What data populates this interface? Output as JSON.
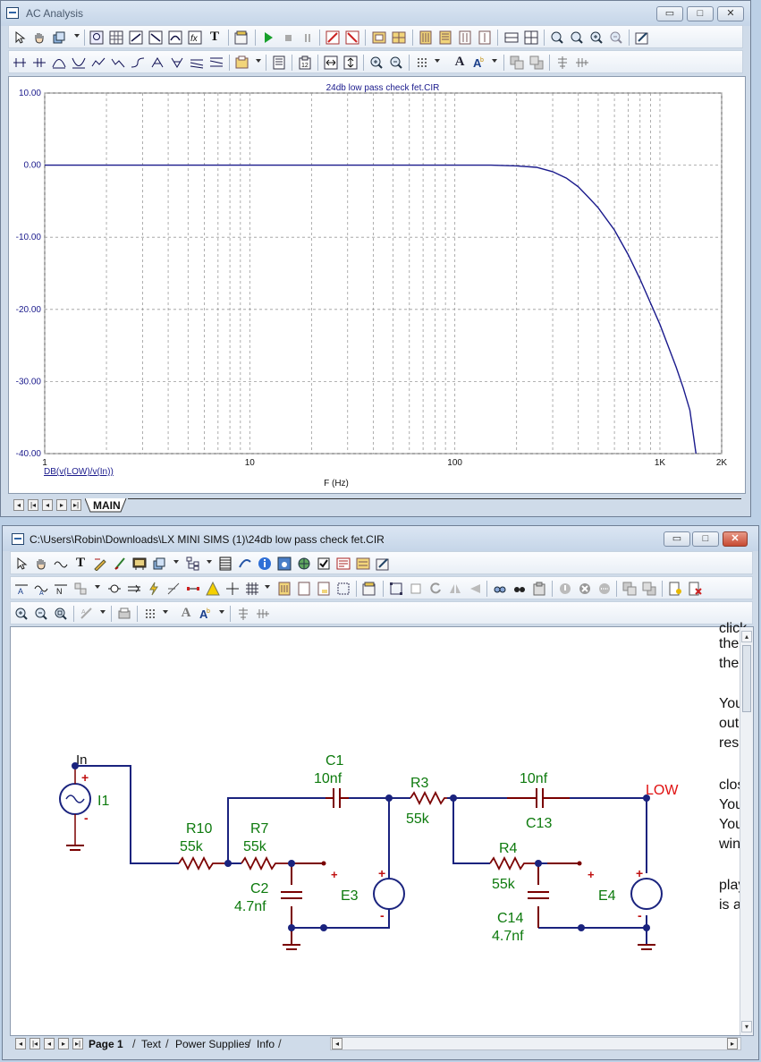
{
  "ac_window": {
    "title": "AC Analysis",
    "buttons": {
      "minimize": "▭",
      "restore": "□",
      "close": "✕"
    },
    "plot": {
      "title": "24db low pass check fet.CIR",
      "y_ticks": [
        "10.00",
        "0.00",
        "-10.00",
        "-20.00",
        "-30.00",
        "-40.00"
      ],
      "x_ticks": [
        "1",
        "10",
        "100",
        "1K",
        "2K"
      ],
      "x_label": "F (Hz)",
      "trace_label": "DB(v(LOW)/v(In))"
    },
    "tabs": [
      {
        "label": "MAIN"
      }
    ]
  },
  "chart_data": {
    "type": "line",
    "title": "24db low pass check fet.CIR",
    "xlabel": "F (Hz)",
    "ylabel": "",
    "x_scale": "log",
    "xlim": [
      1,
      2000
    ],
    "ylim": [
      -40,
      10
    ],
    "grid": true,
    "series": [
      {
        "name": "DB(v(LOW)/v(In))",
        "color": "#1a1a8c",
        "x": [
          1,
          10,
          50,
          100,
          150,
          200,
          250,
          300,
          350,
          400,
          450,
          500,
          600,
          700,
          800,
          1000,
          1200,
          1300,
          1400,
          1500
        ],
        "y": [
          0,
          0,
          0,
          0,
          0,
          -0.1,
          -0.3,
          -0.9,
          -1.8,
          -3.0,
          -4.5,
          -5.9,
          -9.0,
          -12.4,
          -15.8,
          -22.1,
          -28.0,
          -30.9,
          -34.0,
          -40.0
        ]
      }
    ]
  },
  "schematic_window": {
    "title": "C:\\Users\\Robin\\Downloads\\LX MINI SIMS (1)\\24db low pass check fet.CIR",
    "buttons": {
      "minimize": "▭",
      "restore": "□",
      "close": "✕"
    },
    "labels": {
      "in_node": "In",
      "i1": "I1",
      "r10": "R10",
      "r10_val": "55k",
      "r7": "R7",
      "r7_val": "55k",
      "c2": "C2",
      "c2_val": "4.7nf",
      "c1": "C1",
      "c1_val": "10nf",
      "e3": "E3",
      "r3": "R3",
      "r3_val": "55k",
      "c13_val": "10nf",
      "c13": "C13",
      "r4": "R4",
      "r4_val": "55k",
      "c14": "C14",
      "c14_val": "4.7nf",
      "e4": "E4",
      "low_node": "LOW",
      "plus": "+",
      "minus": "-"
    },
    "side_text": [
      "click",
      "then",
      "then",
      "",
      "You",
      "outp",
      "resp",
      "",
      "close",
      "You",
      "You",
      "wind",
      "",
      "play",
      "is a"
    ],
    "tabs": [
      {
        "label": "Page 1"
      },
      {
        "label": "Text"
      },
      {
        "label": "Power Supplies"
      },
      {
        "label": "Info"
      }
    ]
  },
  "colors": {
    "wire_blue": "#1a237e",
    "wire_red": "#7a0000",
    "label_green": "#0d7a0d",
    "node_red": "#e01010",
    "trace": "#1a1a8c"
  }
}
